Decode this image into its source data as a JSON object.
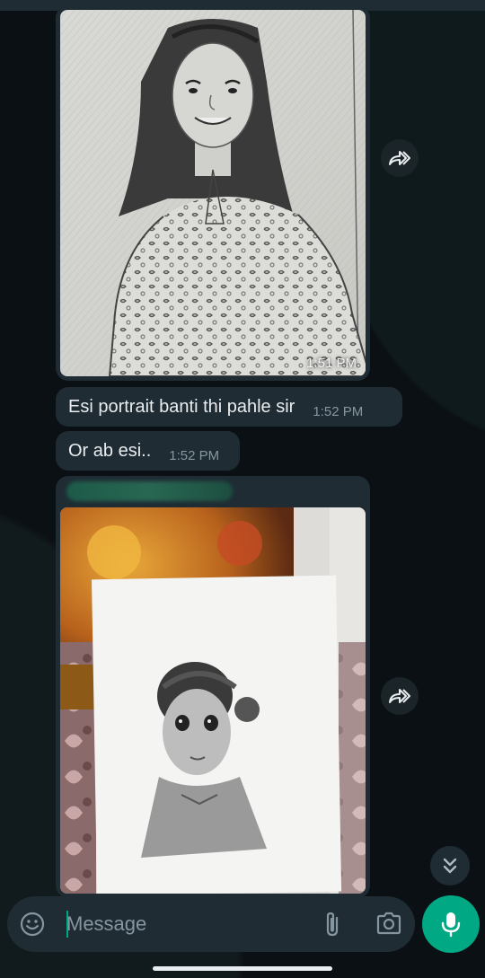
{
  "messages": [
    {
      "type": "image",
      "description": "pencil sketch portrait",
      "time": "1:51 PM"
    },
    {
      "type": "text",
      "text": "Esi portrait banti thi pahle sir",
      "time": "1:52 PM"
    },
    {
      "type": "text",
      "text": "Or ab esi..",
      "time": "1:52 PM"
    },
    {
      "type": "image",
      "description": "pencil drawing of child",
      "time": ""
    }
  ],
  "composer": {
    "placeholder": "Message"
  },
  "icons": {
    "forward": "forward-icon",
    "scroll_down": "double-chevron-down-icon",
    "emoji": "emoji-icon",
    "attach": "paperclip-icon",
    "camera": "camera-icon",
    "mic": "mic-icon"
  },
  "colors": {
    "accent": "#00a884",
    "bubble": "#1f2c34",
    "background": "#0b1014",
    "meta_text": "#8696a0"
  }
}
